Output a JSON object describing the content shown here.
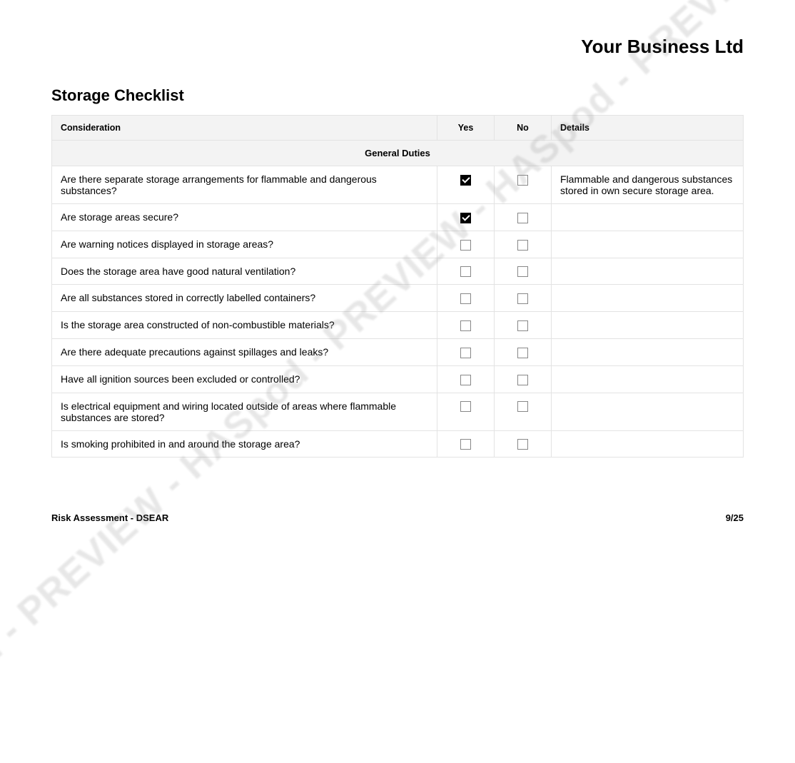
{
  "company": "Your Business Ltd",
  "title": "Storage Checklist",
  "headers": {
    "consideration": "Consideration",
    "yes": "Yes",
    "no": "No",
    "details": "Details"
  },
  "section": "General Duties",
  "rows": [
    {
      "q": "Are there separate storage arrangements for flammable and dangerous substances?",
      "yes": true,
      "no": false,
      "details": "Flammable and dangerous substances stored in own secure storage area."
    },
    {
      "q": "Are storage areas secure?",
      "yes": true,
      "no": false,
      "details": ""
    },
    {
      "q": "Are warning notices displayed in storage areas?",
      "yes": false,
      "no": false,
      "details": ""
    },
    {
      "q": "Does the storage area have good natural ventilation?",
      "yes": false,
      "no": false,
      "details": ""
    },
    {
      "q": "Are all substances stored in correctly labelled containers?",
      "yes": false,
      "no": false,
      "details": ""
    },
    {
      "q": "Is the storage area constructed of non-combustible materials?",
      "yes": false,
      "no": false,
      "details": ""
    },
    {
      "q": "Are there adequate precautions against spillages and leaks?",
      "yes": false,
      "no": false,
      "details": ""
    },
    {
      "q": "Have all ignition sources been excluded or controlled?",
      "yes": false,
      "no": false,
      "details": ""
    },
    {
      "q": "Is electrical equipment and wiring located outside of areas where flammable substances are stored?",
      "yes": false,
      "no": false,
      "details": ""
    },
    {
      "q": "Is smoking prohibited in and around the storage area?",
      "yes": false,
      "no": false,
      "details": ""
    }
  ],
  "footer": {
    "left": "Risk Assessment - DSEAR",
    "right": "9/25"
  },
  "watermark": "HASpod - PREVIEW - HASpod - PREVIEW - HASpod - PREVIEW - HASpod"
}
